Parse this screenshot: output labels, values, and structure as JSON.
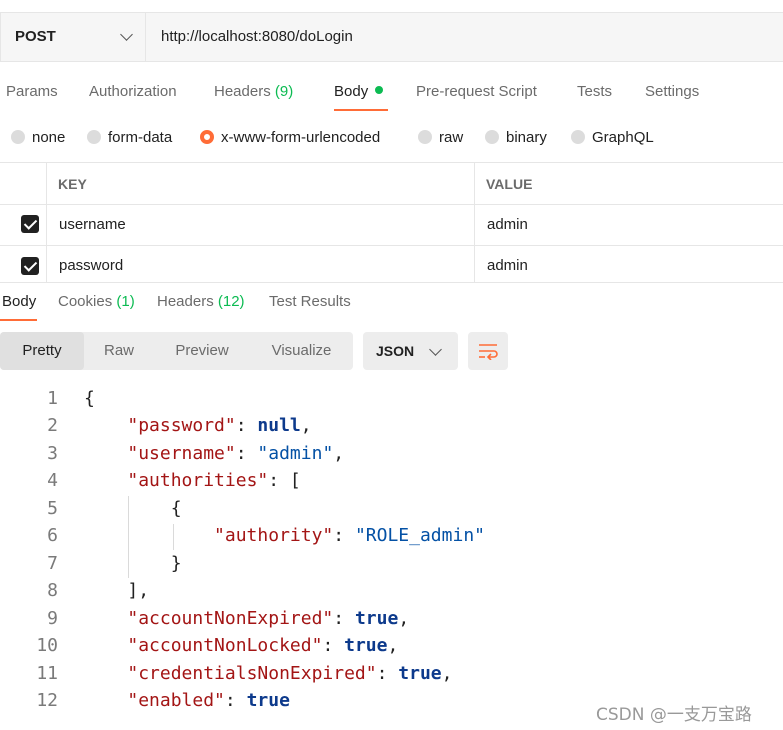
{
  "request": {
    "method": "POST",
    "url": "http://localhost:8080/doLogin"
  },
  "request_tabs": [
    {
      "label": "Params"
    },
    {
      "label": "Authorization"
    },
    {
      "label": "Headers",
      "count": "(9)"
    },
    {
      "label": "Body"
    },
    {
      "label": "Pre-request Script"
    },
    {
      "label": "Tests"
    },
    {
      "label": "Settings"
    }
  ],
  "body_types": [
    "none",
    "form-data",
    "x-www-form-urlencoded",
    "raw",
    "binary",
    "GraphQL"
  ],
  "selected_body_type": "x-www-form-urlencoded",
  "table": {
    "headers": {
      "key": "KEY",
      "value": "VALUE"
    },
    "rows": [
      {
        "checked": true,
        "key": "username",
        "value": "admin"
      },
      {
        "checked": true,
        "key": "password",
        "value": "admin"
      }
    ]
  },
  "response_tabs": [
    {
      "label": "Body"
    },
    {
      "label": "Cookies",
      "count": "(1)"
    },
    {
      "label": "Headers",
      "count": "(12)"
    },
    {
      "label": "Test Results"
    }
  ],
  "view_modes": [
    "Pretty",
    "Raw",
    "Preview",
    "Visualize"
  ],
  "format": "JSON",
  "code": {
    "line_numbers": [
      "1",
      "2",
      "3",
      "4",
      "5",
      "6",
      "7",
      "8",
      "9",
      "10",
      "11",
      "12"
    ],
    "password_key": "\"password\"",
    "password_value": "null",
    "username_key": "\"username\"",
    "username_value": "\"admin\"",
    "authorities_key": "\"authorities\"",
    "authority_key": "\"authority\"",
    "authority_value": "\"ROLE_admin\"",
    "accountNonExpired_key": "\"accountNonExpired\"",
    "accountNonLocked_key": "\"accountNonLocked\"",
    "credentialsNonExpired_key": "\"credentialsNonExpired\"",
    "enabled_key": "\"enabled\"",
    "true_value": "true"
  },
  "watermark": "CSDN @一支万宝路",
  "colors": {
    "accent": "#ff6c37",
    "success": "#0cbb52",
    "string": "#0451a5",
    "key": "#a31515"
  }
}
